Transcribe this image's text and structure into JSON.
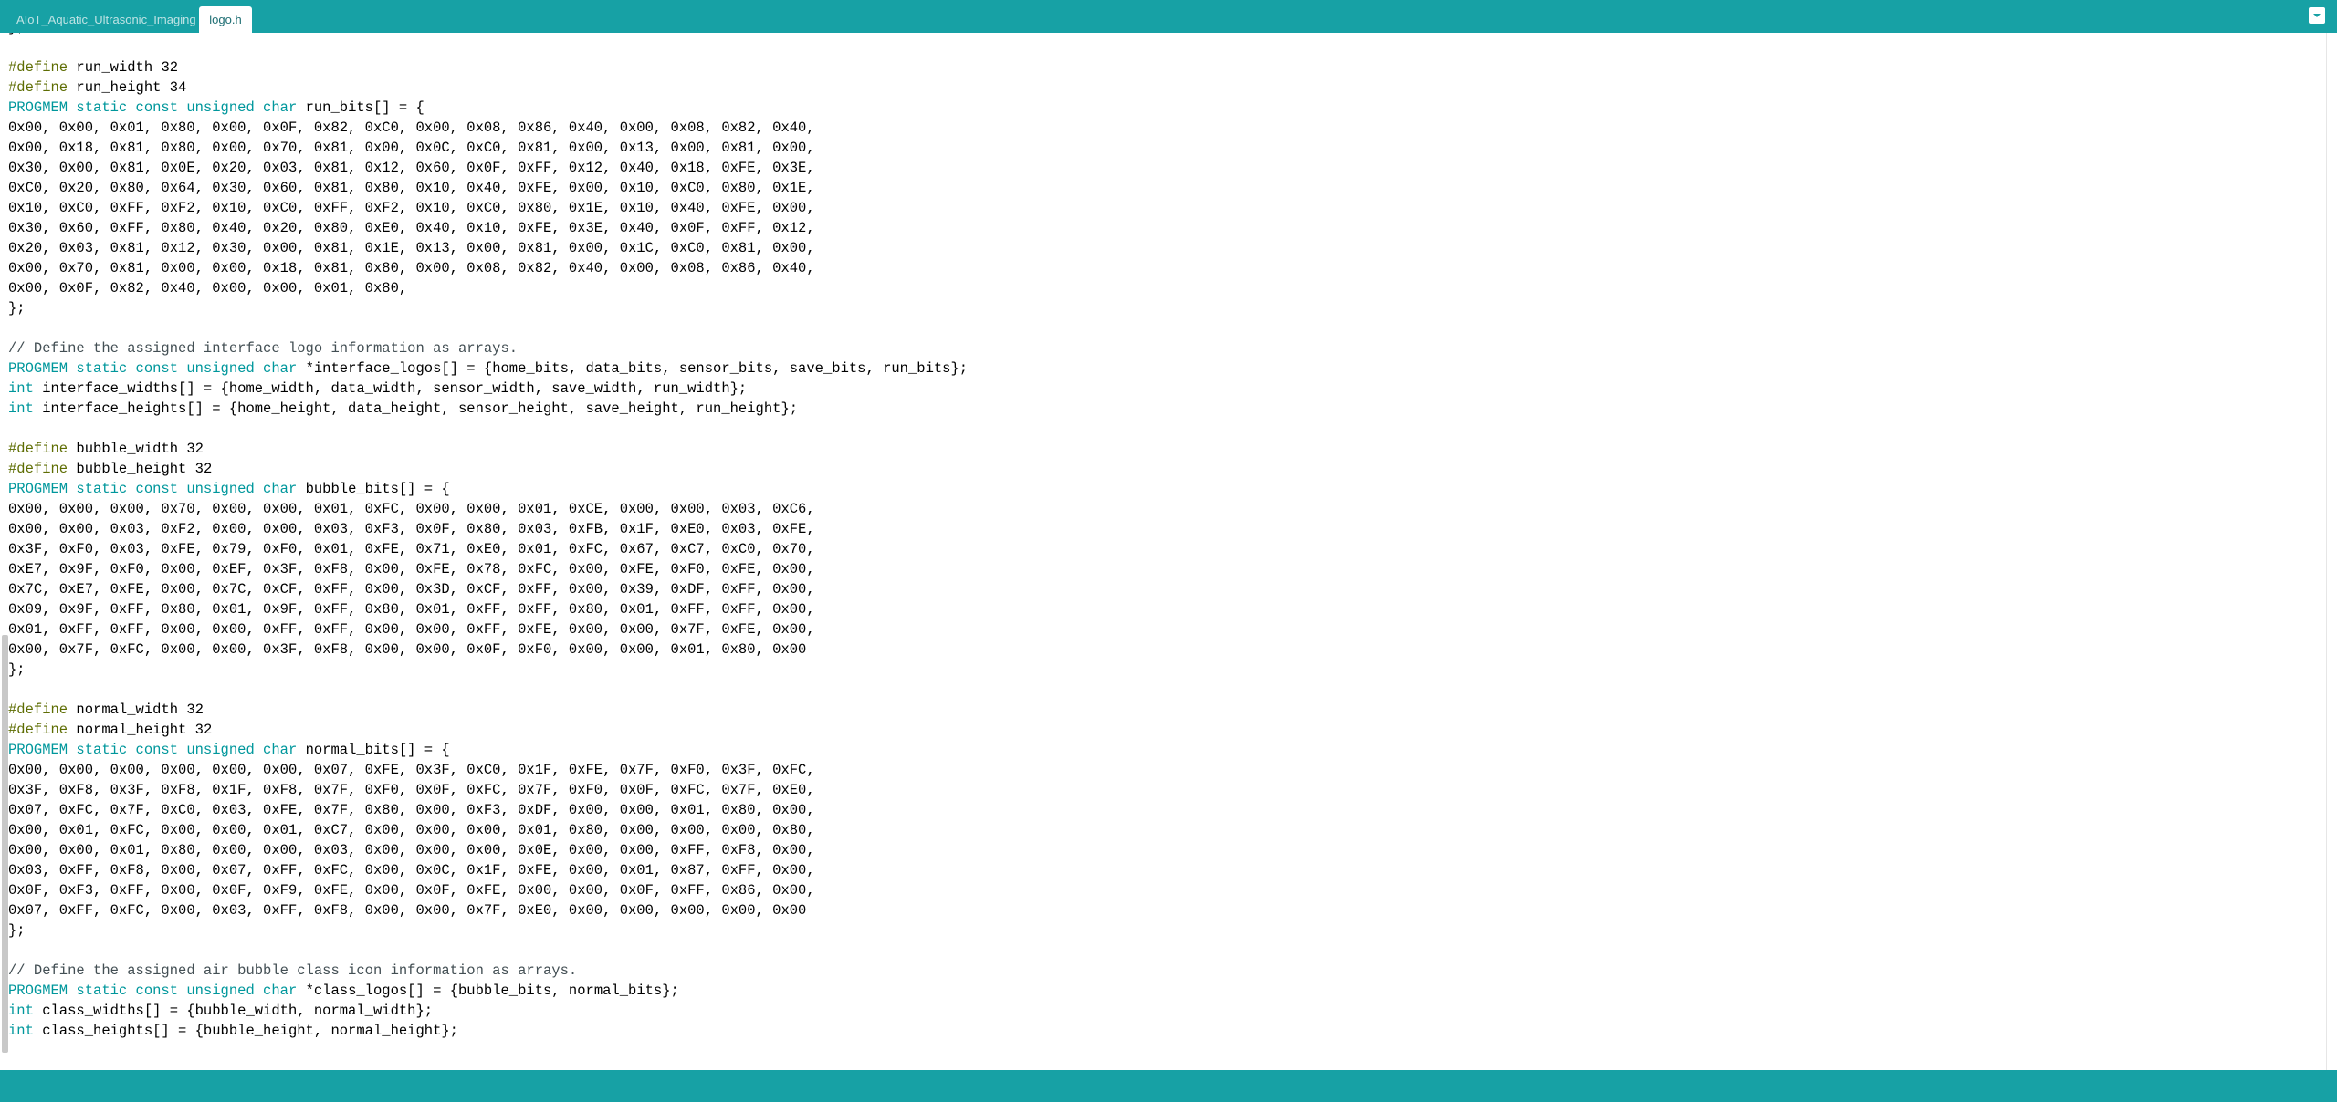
{
  "tabs": [
    {
      "label": "AIoT_Aquatic_Ultrasonic_Imaging",
      "active": false
    },
    {
      "label": "logo.h",
      "active": true
    }
  ],
  "tab_menu_icon": "chevron-down-icon",
  "colors": {
    "accent": "#17a1a5",
    "define_keyword": "#5e6d03",
    "type_keyword": "#00979c",
    "comment": "#434f54"
  },
  "code": {
    "lines": [
      {
        "text": "};"
      },
      {
        "text": ""
      },
      {
        "kw": "#define",
        "text": " run_width 32"
      },
      {
        "kw": "#define",
        "text": " run_height 34"
      },
      {
        "kw": "PROGMEM static const unsigned char",
        "text": " run_bits[] = {"
      },
      {
        "text": "0x00, 0x00, 0x01, 0x80, 0x00, 0x0F, 0x82, 0xC0, 0x00, 0x08, 0x86, 0x40, 0x00, 0x08, 0x82, 0x40,"
      },
      {
        "text": "0x00, 0x18, 0x81, 0x80, 0x00, 0x70, 0x81, 0x00, 0x0C, 0xC0, 0x81, 0x00, 0x13, 0x00, 0x81, 0x00,"
      },
      {
        "text": "0x30, 0x00, 0x81, 0x0E, 0x20, 0x03, 0x81, 0x12, 0x60, 0x0F, 0xFF, 0x12, 0x40, 0x18, 0xFE, 0x3E,"
      },
      {
        "text": "0xC0, 0x20, 0x80, 0x64, 0x30, 0x60, 0x81, 0x80, 0x10, 0x40, 0xFE, 0x00, 0x10, 0xC0, 0x80, 0x1E,"
      },
      {
        "text": "0x10, 0xC0, 0xFF, 0xF2, 0x10, 0xC0, 0xFF, 0xF2, 0x10, 0xC0, 0x80, 0x1E, 0x10, 0x40, 0xFE, 0x00,"
      },
      {
        "text": "0x30, 0x60, 0xFF, 0x80, 0x40, 0x20, 0x80, 0xE0, 0x40, 0x10, 0xFE, 0x3E, 0x40, 0x0F, 0xFF, 0x12,"
      },
      {
        "text": "0x20, 0x03, 0x81, 0x12, 0x30, 0x00, 0x81, 0x1E, 0x13, 0x00, 0x81, 0x00, 0x1C, 0xC0, 0x81, 0x00,"
      },
      {
        "text": "0x00, 0x70, 0x81, 0x00, 0x00, 0x18, 0x81, 0x80, 0x00, 0x08, 0x82, 0x40, 0x00, 0x08, 0x86, 0x40,"
      },
      {
        "text": "0x00, 0x0F, 0x82, 0x40, 0x00, 0x00, 0x01, 0x80,"
      },
      {
        "text": "};"
      },
      {
        "text": ""
      },
      {
        "comment": "// Define the assigned interface logo information as arrays."
      },
      {
        "kw": "PROGMEM static const unsigned char",
        "text": " *interface_logos[] = {home_bits, data_bits, sensor_bits, save_bits, run_bits};"
      },
      {
        "kw": "int",
        "text": " interface_widths[] = {home_width, data_width, sensor_width, save_width, run_width};"
      },
      {
        "kw": "int",
        "text": " interface_heights[] = {home_height, data_height, sensor_height, save_height, run_height};"
      },
      {
        "text": ""
      },
      {
        "kw": "#define",
        "text": " bubble_width 32"
      },
      {
        "kw": "#define",
        "text": " bubble_height 32"
      },
      {
        "kw": "PROGMEM static const unsigned char",
        "text": " bubble_bits[] = {"
      },
      {
        "text": "0x00, 0x00, 0x00, 0x70, 0x00, 0x00, 0x01, 0xFC, 0x00, 0x00, 0x01, 0xCE, 0x00, 0x00, 0x03, 0xC6,"
      },
      {
        "text": "0x00, 0x00, 0x03, 0xF2, 0x00, 0x00, 0x03, 0xF3, 0x0F, 0x80, 0x03, 0xFB, 0x1F, 0xE0, 0x03, 0xFE,"
      },
      {
        "text": "0x3F, 0xF0, 0x03, 0xFE, 0x79, 0xF0, 0x01, 0xFE, 0x71, 0xE0, 0x01, 0xFC, 0x67, 0xC7, 0xC0, 0x70,"
      },
      {
        "text": "0xE7, 0x9F, 0xF0, 0x00, 0xEF, 0x3F, 0xF8, 0x00, 0xFE, 0x78, 0xFC, 0x00, 0xFE, 0xF0, 0xFE, 0x00,"
      },
      {
        "text": "0x7C, 0xE7, 0xFE, 0x00, 0x7C, 0xCF, 0xFF, 0x00, 0x3D, 0xCF, 0xFF, 0x00, 0x39, 0xDF, 0xFF, 0x00,"
      },
      {
        "text": "0x09, 0x9F, 0xFF, 0x80, 0x01, 0x9F, 0xFF, 0x80, 0x01, 0xFF, 0xFF, 0x80, 0x01, 0xFF, 0xFF, 0x00,"
      },
      {
        "text": "0x01, 0xFF, 0xFF, 0x00, 0x00, 0xFF, 0xFF, 0x00, 0x00, 0xFF, 0xFE, 0x00, 0x00, 0x7F, 0xFE, 0x00,"
      },
      {
        "text": "0x00, 0x7F, 0xFC, 0x00, 0x00, 0x3F, 0xF8, 0x00, 0x00, 0x0F, 0xF0, 0x00, 0x00, 0x01, 0x80, 0x00"
      },
      {
        "text": "};"
      },
      {
        "text": ""
      },
      {
        "kw": "#define",
        "text": " normal_width 32"
      },
      {
        "kw": "#define",
        "text": " normal_height 32"
      },
      {
        "kw": "PROGMEM static const unsigned char",
        "text": " normal_bits[] = {"
      },
      {
        "text": "0x00, 0x00, 0x00, 0x00, 0x00, 0x00, 0x07, 0xFE, 0x3F, 0xC0, 0x1F, 0xFE, 0x7F, 0xF0, 0x3F, 0xFC,"
      },
      {
        "text": "0x3F, 0xF8, 0x3F, 0xF8, 0x1F, 0xF8, 0x7F, 0xF0, 0x0F, 0xFC, 0x7F, 0xF0, 0x0F, 0xFC, 0x7F, 0xE0,"
      },
      {
        "text": "0x07, 0xFC, 0x7F, 0xC0, 0x03, 0xFE, 0x7F, 0x80, 0x00, 0xF3, 0xDF, 0x00, 0x00, 0x01, 0x80, 0x00,"
      },
      {
        "text": "0x00, 0x01, 0xFC, 0x00, 0x00, 0x01, 0xC7, 0x00, 0x00, 0x00, 0x01, 0x80, 0x00, 0x00, 0x00, 0x80,"
      },
      {
        "text": "0x00, 0x00, 0x01, 0x80, 0x00, 0x00, 0x03, 0x00, 0x00, 0x00, 0x0E, 0x00, 0x00, 0xFF, 0xF8, 0x00,"
      },
      {
        "text": "0x03, 0xFF, 0xF8, 0x00, 0x07, 0xFF, 0xFC, 0x00, 0x0C, 0x1F, 0xFE, 0x00, 0x01, 0x87, 0xFF, 0x00,"
      },
      {
        "text": "0x0F, 0xF3, 0xFF, 0x00, 0x0F, 0xF9, 0xFE, 0x00, 0x0F, 0xFE, 0x00, 0x00, 0x0F, 0xFF, 0x86, 0x00,"
      },
      {
        "text": "0x07, 0xFF, 0xFC, 0x00, 0x03, 0xFF, 0xF8, 0x00, 0x00, 0x7F, 0xE0, 0x00, 0x00, 0x00, 0x00, 0x00"
      },
      {
        "text": "};"
      },
      {
        "text": ""
      },
      {
        "comment": "// Define the assigned air bubble class icon information as arrays."
      },
      {
        "kw": "PROGMEM static const unsigned char",
        "text": " *class_logos[] = {bubble_bits, normal_bits};"
      },
      {
        "kw": "int",
        "text": " class_widths[] = {bubble_width, normal_width};"
      },
      {
        "kw": "int",
        "text": " class_heights[] = {bubble_height, normal_height};"
      }
    ]
  }
}
